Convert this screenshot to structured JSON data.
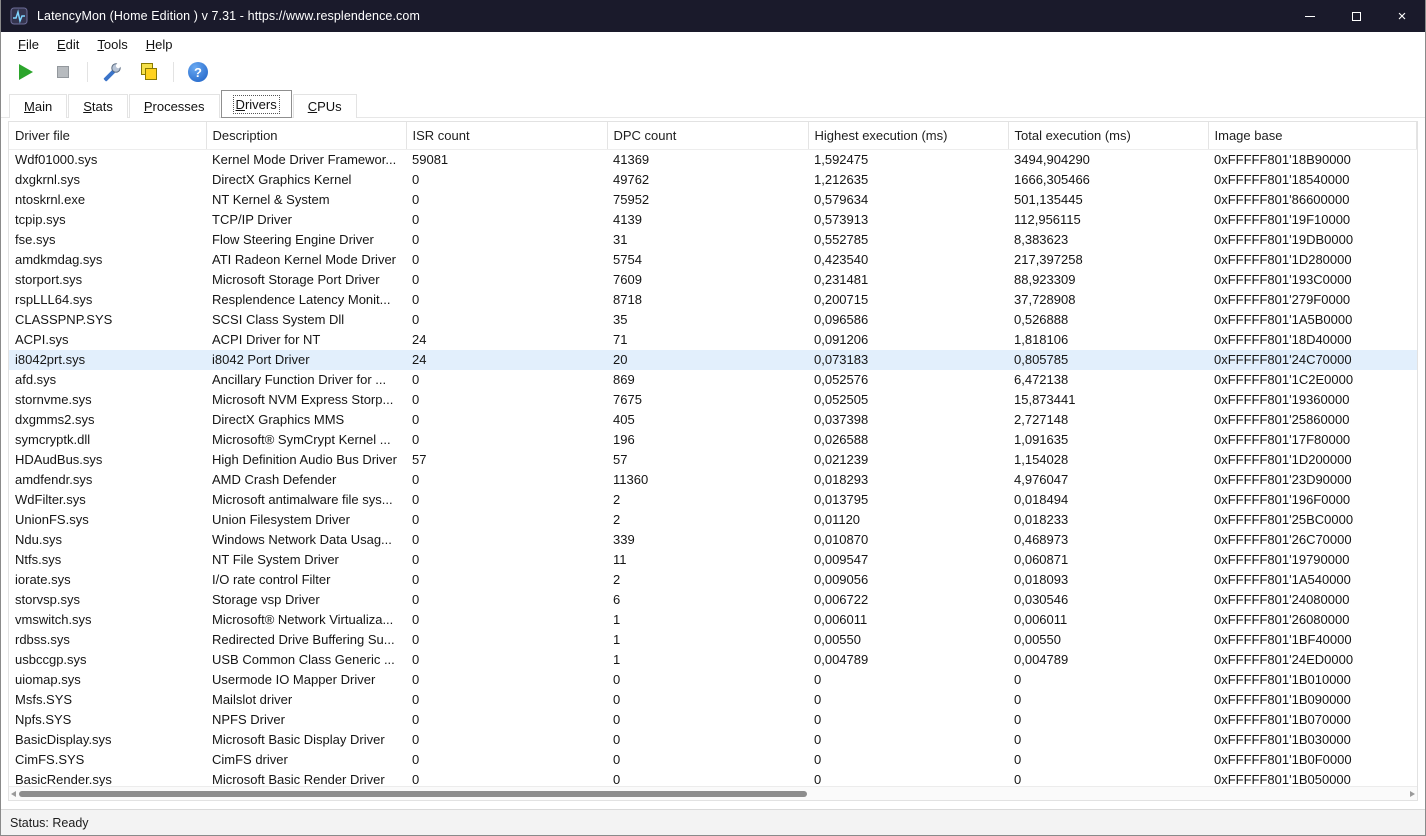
{
  "window": {
    "title": "LatencyMon  (Home Edition )  v 7.31 - https://www.resplendence.com",
    "app_icon": "latencymon-app-icon",
    "controls": {
      "minimize": "minimize",
      "maximize": "maximize",
      "close": "close"
    }
  },
  "menubar": {
    "items": [
      "File",
      "Edit",
      "Tools",
      "Help"
    ]
  },
  "toolbar": {
    "buttons": [
      "start-monitor",
      "stop-monitor",
      "edit-options",
      "copy-report",
      "help"
    ]
  },
  "tabs": {
    "items": [
      "Main",
      "Stats",
      "Processes",
      "Drivers",
      "CPUs"
    ],
    "selected_index": 3,
    "selected": "Drivers"
  },
  "table": {
    "columns": [
      "Driver file",
      "Description",
      "ISR count",
      "DPC count",
      "Highest execution (ms)",
      "Total execution (ms)",
      "Image base"
    ],
    "selected_index": 10,
    "selected_row": "i8042prt.sys",
    "rows": [
      [
        "Wdf01000.sys",
        "Kernel Mode Driver Framewor...",
        "59081",
        "41369",
        "1,592475",
        "3494,904290",
        "0xFFFFF801'18B90000"
      ],
      [
        "dxgkrnl.sys",
        "DirectX Graphics Kernel",
        "0",
        "49762",
        "1,212635",
        "1666,305466",
        "0xFFFFF801'18540000"
      ],
      [
        "ntoskrnl.exe",
        "NT Kernel & System",
        "0",
        "75952",
        "0,579634",
        "501,135445",
        "0xFFFFF801'86600000"
      ],
      [
        "tcpip.sys",
        "TCP/IP Driver",
        "0",
        "4139",
        "0,573913",
        "112,956115",
        "0xFFFFF801'19F10000"
      ],
      [
        "fse.sys",
        "Flow Steering Engine Driver",
        "0",
        "31",
        "0,552785",
        "8,383623",
        "0xFFFFF801'19DB0000"
      ],
      [
        "amdkmdag.sys",
        "ATI Radeon Kernel Mode Driver",
        "0",
        "5754",
        "0,423540",
        "217,397258",
        "0xFFFFF801'1D280000"
      ],
      [
        "storport.sys",
        "Microsoft Storage Port Driver",
        "0",
        "7609",
        "0,231481",
        "88,923309",
        "0xFFFFF801'193C0000"
      ],
      [
        "rspLLL64.sys",
        "Resplendence Latency Monit...",
        "0",
        "8718",
        "0,200715",
        "37,728908",
        "0xFFFFF801'279F0000"
      ],
      [
        "CLASSPNP.SYS",
        "SCSI Class System Dll",
        "0",
        "35",
        "0,096586",
        "0,526888",
        "0xFFFFF801'1A5B0000"
      ],
      [
        "ACPI.sys",
        "ACPI Driver for NT",
        "24",
        "71",
        "0,091206",
        "1,818106",
        "0xFFFFF801'18D40000"
      ],
      [
        "i8042prt.sys",
        "i8042 Port Driver",
        "24",
        "20",
        "0,073183",
        "0,805785",
        "0xFFFFF801'24C70000"
      ],
      [
        "afd.sys",
        "Ancillary Function Driver for ...",
        "0",
        "869",
        "0,052576",
        "6,472138",
        "0xFFFFF801'1C2E0000"
      ],
      [
        "stornvme.sys",
        "Microsoft NVM Express Storp...",
        "0",
        "7675",
        "0,052505",
        "15,873441",
        "0xFFFFF801'19360000"
      ],
      [
        "dxgmms2.sys",
        "DirectX Graphics MMS",
        "0",
        "405",
        "0,037398",
        "2,727148",
        "0xFFFFF801'25860000"
      ],
      [
        "symcryptk.dll",
        "Microsoft® SymCrypt Kernel ...",
        "0",
        "196",
        "0,026588",
        "1,091635",
        "0xFFFFF801'17F80000"
      ],
      [
        "HDAudBus.sys",
        "High Definition Audio Bus Driver",
        "57",
        "57",
        "0,021239",
        "1,154028",
        "0xFFFFF801'1D200000"
      ],
      [
        "amdfendr.sys",
        "AMD Crash Defender",
        "0",
        "11360",
        "0,018293",
        "4,976047",
        "0xFFFFF801'23D90000"
      ],
      [
        "WdFilter.sys",
        "Microsoft antimalware file sys...",
        "0",
        "2",
        "0,013795",
        "0,018494",
        "0xFFFFF801'196F0000"
      ],
      [
        "UnionFS.sys",
        "Union Filesystem Driver",
        "0",
        "2",
        "0,01120",
        "0,018233",
        "0xFFFFF801'25BC0000"
      ],
      [
        "Ndu.sys",
        "Windows Network Data Usag...",
        "0",
        "339",
        "0,010870",
        "0,468973",
        "0xFFFFF801'26C70000"
      ],
      [
        "Ntfs.sys",
        "NT File System Driver",
        "0",
        "11",
        "0,009547",
        "0,060871",
        "0xFFFFF801'19790000"
      ],
      [
        "iorate.sys",
        "I/O rate control Filter",
        "0",
        "2",
        "0,009056",
        "0,018093",
        "0xFFFFF801'1A540000"
      ],
      [
        "storvsp.sys",
        "Storage vsp Driver",
        "0",
        "6",
        "0,006722",
        "0,030546",
        "0xFFFFF801'24080000"
      ],
      [
        "vmswitch.sys",
        "Microsoft® Network Virtualiza...",
        "0",
        "1",
        "0,006011",
        "0,006011",
        "0xFFFFF801'26080000"
      ],
      [
        "rdbss.sys",
        "Redirected Drive Buffering Su...",
        "0",
        "1",
        "0,00550",
        "0,00550",
        "0xFFFFF801'1BF40000"
      ],
      [
        "usbccgp.sys",
        "USB Common Class Generic ...",
        "0",
        "1",
        "0,004789",
        "0,004789",
        "0xFFFFF801'24ED0000"
      ],
      [
        "uiomap.sys",
        "Usermode IO Mapper Driver",
        "0",
        "0",
        "0",
        "0",
        "0xFFFFF801'1B010000"
      ],
      [
        "Msfs.SYS",
        "Mailslot driver",
        "0",
        "0",
        "0",
        "0",
        "0xFFFFF801'1B090000"
      ],
      [
        "Npfs.SYS",
        "NPFS Driver",
        "0",
        "0",
        "0",
        "0",
        "0xFFFFF801'1B070000"
      ],
      [
        "BasicDisplay.sys",
        "Microsoft Basic Display Driver",
        "0",
        "0",
        "0",
        "0",
        "0xFFFFF801'1B030000"
      ],
      [
        "CimFS.SYS",
        "CimFS driver",
        "0",
        "0",
        "0",
        "0",
        "0xFFFFF801'1B0F0000"
      ],
      [
        "BasicRender.sys",
        "Microsoft Basic Render Driver",
        "0",
        "0",
        "0",
        "0",
        "0xFFFFF801'1B050000"
      ]
    ]
  },
  "statusbar": {
    "text": "Status: Ready"
  },
  "colors": {
    "titlebar_bg": "#1a1a2b",
    "selection_bg": "#e2effc",
    "play_green": "#2ca52c",
    "help_blue": "#1b5fc4"
  }
}
